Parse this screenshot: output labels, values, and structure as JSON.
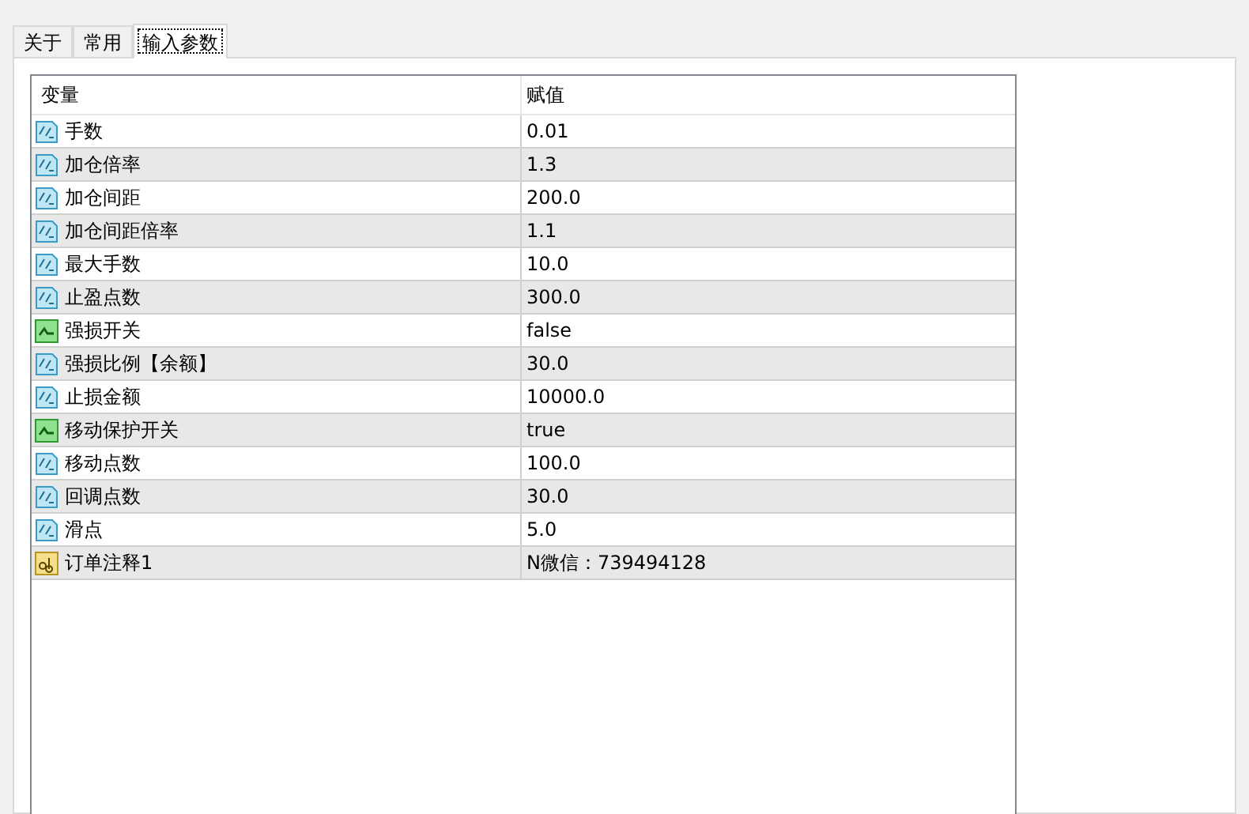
{
  "tabs": [
    {
      "label": "关于",
      "selected": false
    },
    {
      "label": "常用",
      "selected": false
    },
    {
      "label": "输入参数",
      "selected": true
    }
  ],
  "table": {
    "columns": [
      "变量",
      "赋值"
    ],
    "rows": [
      {
        "kind": "number",
        "name": "手数",
        "value": "0.01"
      },
      {
        "kind": "number",
        "name": "加仓倍率",
        "value": "1.3"
      },
      {
        "kind": "number",
        "name": "加仓间距",
        "value": "200.0"
      },
      {
        "kind": "number",
        "name": "加仓间距倍率",
        "value": "1.1"
      },
      {
        "kind": "number",
        "name": "最大手数",
        "value": "10.0"
      },
      {
        "kind": "number",
        "name": "止盈点数",
        "value": "300.0"
      },
      {
        "kind": "bool",
        "name": "强损开关",
        "value": "false"
      },
      {
        "kind": "number",
        "name": "强损比例【余额】",
        "value": "30.0"
      },
      {
        "kind": "number",
        "name": "止损金额",
        "value": "10000.0"
      },
      {
        "kind": "bool",
        "name": "移动保护开关",
        "value": "true"
      },
      {
        "kind": "number",
        "name": "移动点数",
        "value": "100.0"
      },
      {
        "kind": "number",
        "name": "回调点数",
        "value": "30.0"
      },
      {
        "kind": "number",
        "name": "滑点",
        "value": "5.0"
      },
      {
        "kind": "string",
        "name": "订单注释1",
        "value": "N微信：739494128"
      }
    ]
  }
}
